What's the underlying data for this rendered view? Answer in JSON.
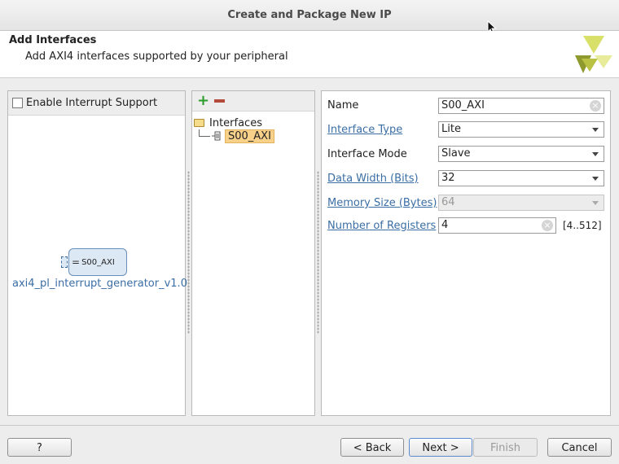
{
  "window": {
    "title": "Create and Package New IP"
  },
  "header": {
    "title": "Add Interfaces",
    "subtitle": "Add AXI4 interfaces supported by your peripheral"
  },
  "left_panel": {
    "checkbox_label": "Enable Interrupt Support",
    "checkbox_checked": false,
    "ip_block_port": "S00_AXI",
    "ip_name": "axi4_pl_interrupt_generator_v1.0"
  },
  "tree": {
    "root": "Interfaces",
    "items": [
      "S00_AXI"
    ]
  },
  "form": {
    "name_label": "Name",
    "name_value": "S00_AXI",
    "interface_type_label": "Interface Type",
    "interface_type_value": "Lite",
    "interface_mode_label": "Interface Mode",
    "interface_mode_value": "Slave",
    "data_width_label": "Data Width (Bits)",
    "data_width_value": "32",
    "memory_size_label": "Memory Size (Bytes)",
    "memory_size_value": "64",
    "num_registers_label": "Number of Registers",
    "num_registers_value": "4",
    "num_registers_range": "[4..512]"
  },
  "buttons": {
    "help": "?",
    "back": "< Back",
    "next": "Next >",
    "finish": "Finish",
    "cancel": "Cancel"
  },
  "colors": {
    "link": "#3a6ea5",
    "selection": "#f7d08a",
    "add": "#2a9d2a",
    "remove": "#b34a3a"
  }
}
